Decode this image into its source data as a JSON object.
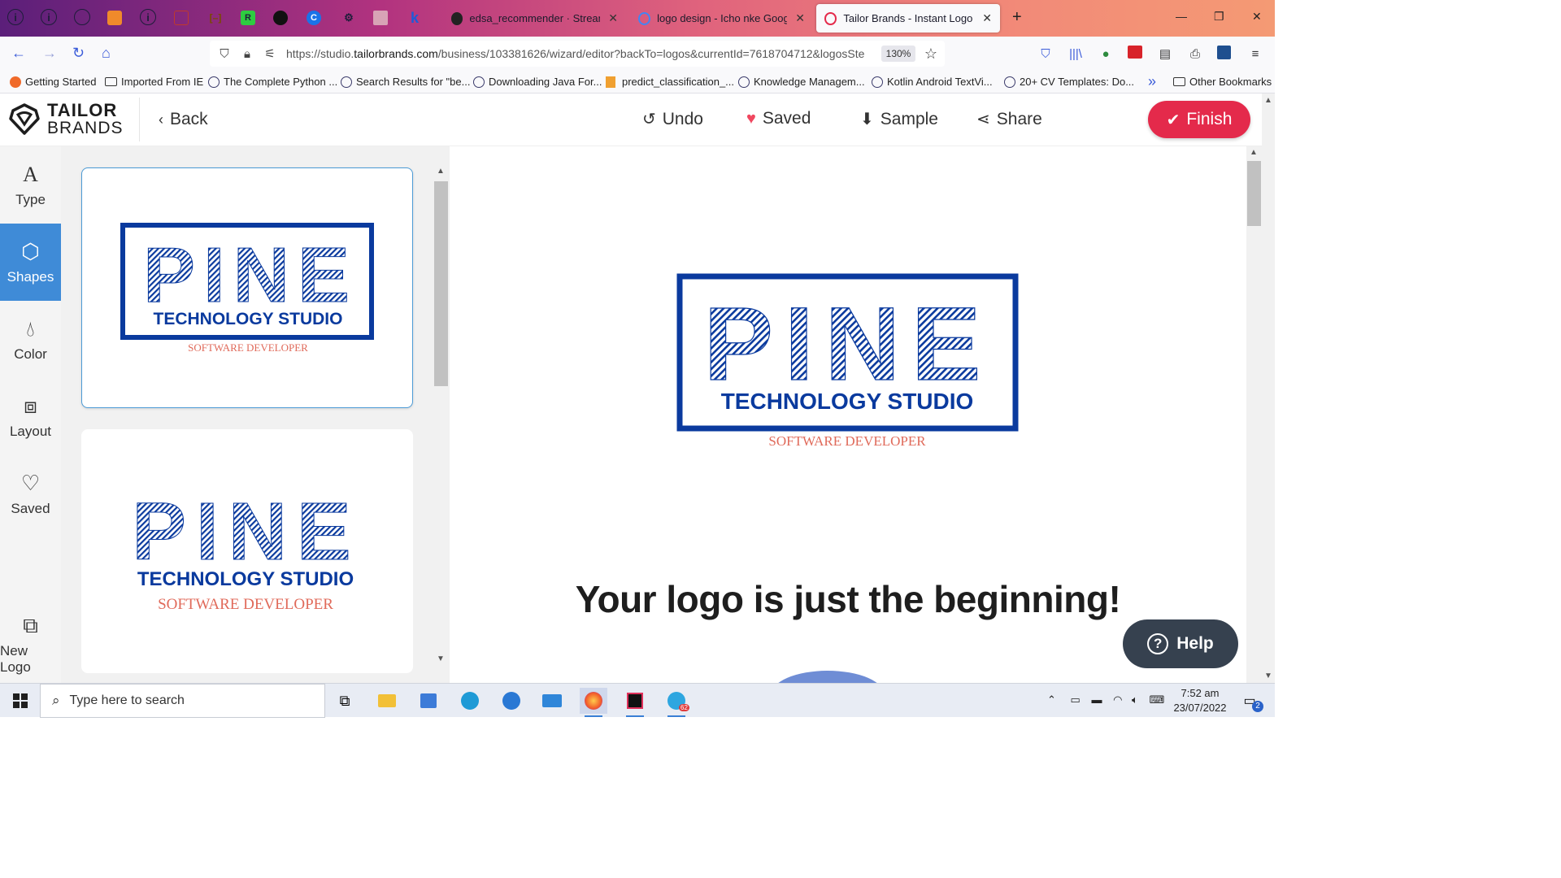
{
  "browser": {
    "pinned_tabs": [
      "i",
      "i",
      "globe",
      "box",
      "i",
      "chart",
      "bracket",
      "R",
      "github",
      "C",
      "bike",
      "qr",
      "k"
    ],
    "tabs": [
      {
        "title": "edsa_recommender · Streamlit",
        "active": false
      },
      {
        "title": "logo design - Icho nke Google",
        "active": false
      },
      {
        "title": "Tailor Brands - Instant Logo Ma",
        "active": true
      }
    ],
    "new_tab": "+",
    "url_prefix": "https://studio.",
    "url_domain": "tailorbrands.com",
    "url_rest": "/business/103381626/wizard/editor?backTo=logos&currentId=7618704712&logosSte",
    "zoom": "130%",
    "bookmarks": [
      "Getting Started",
      "Imported From IE",
      "The Complete Python ...",
      "Search Results for \"be...",
      "Downloading Java For...",
      "predict_classification_...",
      "Knowledge Managem...",
      "Kotlin Android TextVi...",
      "20+ CV Templates: Do..."
    ],
    "more_bookmarks": "»",
    "other_bookmarks": "Other Bookmarks"
  },
  "header": {
    "brand_line1": "TAILOR",
    "brand_line2": "BRANDS",
    "back": "Back",
    "undo": "Undo",
    "saved": "Saved",
    "sample": "Sample",
    "share": "Share",
    "finish": "Finish"
  },
  "rail": [
    {
      "label": "Type",
      "icon": "type-icon",
      "active": false
    },
    {
      "label": "Shapes",
      "icon": "shapes-icon",
      "active": true
    },
    {
      "label": "Color",
      "icon": "droplet-icon",
      "active": false
    },
    {
      "label": "Layout",
      "icon": "layout-icon",
      "active": false
    },
    {
      "label": "Saved",
      "icon": "heart-icon",
      "active": false
    },
    {
      "label": "New Logo",
      "icon": "new-logo-icon",
      "active": false
    }
  ],
  "logo": {
    "name": "PINE",
    "subtitle": "TECHNOLOGY STUDIO",
    "tagline": "SOFTWARE DEVELOPER",
    "primary_color": "#0a3a9e",
    "tagline_color": "#e06a5a"
  },
  "canvas": {
    "headline": "Your logo is just the beginning!",
    "help": "Help"
  },
  "taskbar": {
    "search_placeholder": "Type here to search",
    "time": "7:52 am",
    "date": "23/07/2022",
    "notification_count": "2",
    "telegram_badge": "62"
  }
}
